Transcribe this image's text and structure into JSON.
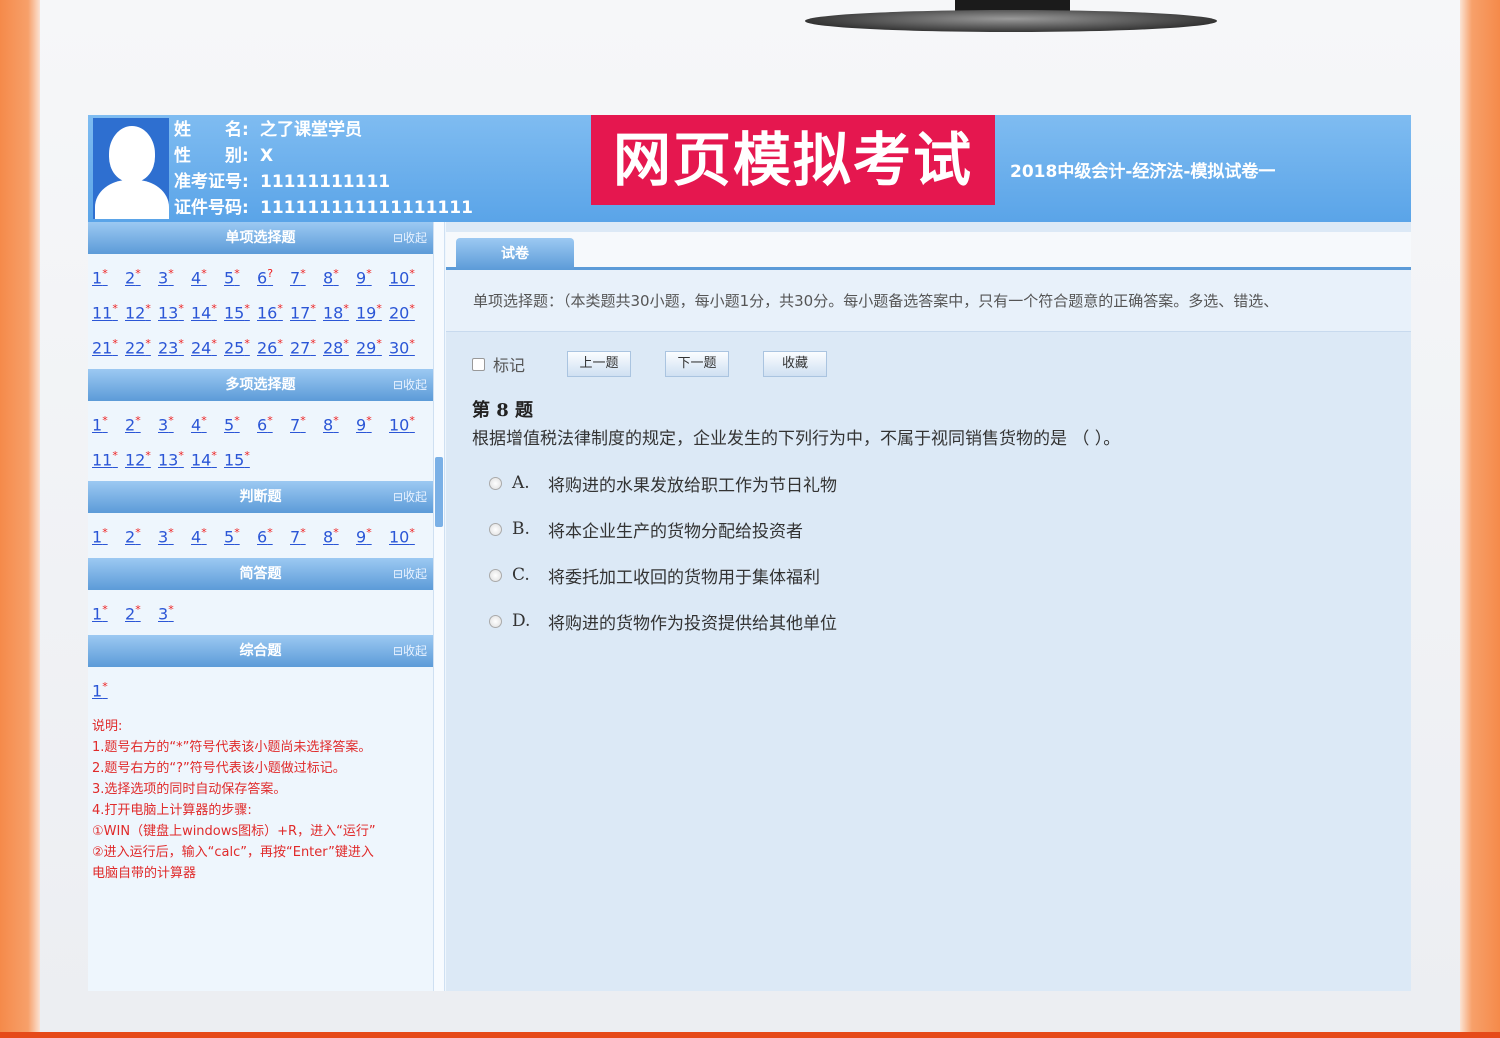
{
  "header": {
    "name_label": "姓　　名:",
    "name_value": "之了课堂学员",
    "gender_label": "性　　别:",
    "gender_value": "X",
    "ticket_label": "准考证号:",
    "ticket_value": "11111111111",
    "id_label": "证件号码:",
    "id_value": "111111111111111111",
    "brand": "网页模拟考试",
    "paper_title": "2018中级会计-经济法-模拟试卷一"
  },
  "sidebar": {
    "collapse_label": "⊟收起",
    "sections": [
      {
        "title": "单项选择题",
        "rows": [
          [
            "1",
            "2",
            "3",
            "4",
            "5",
            "6",
            "7",
            "8",
            "9",
            "10"
          ],
          [
            "11",
            "12",
            "13",
            "14",
            "15",
            "16",
            "17",
            "18",
            "19",
            "20"
          ],
          [
            "21",
            "22",
            "23",
            "24",
            "25",
            "26",
            "27",
            "28",
            "29",
            "30"
          ]
        ]
      },
      {
        "title": "多项选择题",
        "rows": [
          [
            "1",
            "2",
            "3",
            "4",
            "5",
            "6",
            "7",
            "8",
            "9",
            "10"
          ],
          [
            "11",
            "12",
            "13",
            "14",
            "15"
          ]
        ]
      },
      {
        "title": "判断题",
        "rows": [
          [
            "1",
            "2",
            "3",
            "4",
            "5",
            "6",
            "7",
            "8",
            "9",
            "10"
          ]
        ]
      },
      {
        "title": "简答题",
        "rows": [
          [
            "1",
            "2",
            "3"
          ]
        ]
      },
      {
        "title": "综合题",
        "rows": [
          [
            "1"
          ]
        ]
      }
    ],
    "notes": [
      "说明:",
      "1.题号右方的“*”符号代表该小题尚未选择答案。",
      "2.题号右方的“?”符号代表该小题做过标记。",
      "3.选择选项的同时自动保存答案。",
      "4.打开电脑上计算器的步骤:",
      "①WIN（键盘上windows图标）+R，进入“运行”",
      "②进入运行后，输入“calc”，再按“Enter”键进入",
      "电脑自带的计算器"
    ]
  },
  "main": {
    "tab_label": "试卷",
    "instructions": "单项选择题：（本类题共30小题，每小题1分，共30分。每小题备选答案中，只有一个符合题意的正确答案。多选、错选、",
    "mark_label": "标记",
    "prev_label": "上一题",
    "next_label": "下一题",
    "fav_label": "收藏",
    "question_title": "第 8 题",
    "question_text": "根据增值税法律制度的规定，企业发生的下列行为中，不属于视同销售货物的是 （ ）。",
    "options": [
      {
        "key": "A.",
        "text": "将购进的水果发放给职工作为节日礼物"
      },
      {
        "key": "B.",
        "text": "将本企业生产的货物分配给投资者"
      },
      {
        "key": "C.",
        "text": "将委托加工收回的货物用于集体福利"
      },
      {
        "key": "D.",
        "text": "将购进的货物作为投资提供给其他单位"
      }
    ]
  }
}
